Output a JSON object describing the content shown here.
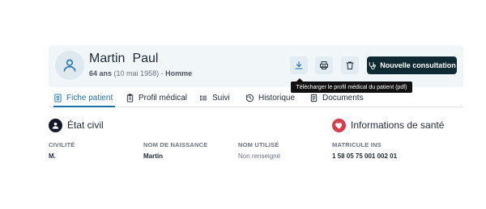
{
  "patient": {
    "last_name": "Martin",
    "first_name": "Paul",
    "age": "64 ans",
    "birthdate": "(10 mai 1958)",
    "separator": "-",
    "gender": "Homme"
  },
  "toolbar": {
    "download_icon": "download-icon",
    "print_icon": "print-icon",
    "delete_icon": "trash-icon",
    "new_consultation_label": "Nouvelle consultation",
    "tooltip": "Télécharger le profil médical du patient (pdf)"
  },
  "tabs": [
    {
      "label": "Fiche patient",
      "icon": "id-card-icon",
      "active": true
    },
    {
      "label": "Profil médical",
      "icon": "clipboard-icon",
      "active": false
    },
    {
      "label": "Suivi",
      "icon": "dots-list-icon",
      "active": false
    },
    {
      "label": "Historique",
      "icon": "history-icon",
      "active": false
    },
    {
      "label": "Documents",
      "icon": "document-icon",
      "active": false
    }
  ],
  "sections": {
    "civil": {
      "title": "État civil",
      "icon": "person-icon"
    },
    "health": {
      "title": "Informations de santé",
      "icon": "heart-icon"
    }
  },
  "fields": [
    {
      "label": "CIVILITÉ",
      "value": "M."
    },
    {
      "label": "NOM DE NAISSANCE",
      "value": "Martin"
    },
    {
      "label": "NOM UTILISÉ",
      "value": "Non renseigné"
    },
    {
      "label": "MATRICULE INS",
      "value": "1 58 05 75 001 002 01"
    }
  ],
  "colors": {
    "accent": "#1d6fa3",
    "primary_button": "#102a33",
    "header_background": "#f1f6f9",
    "health_badge": "#d63c4a"
  }
}
